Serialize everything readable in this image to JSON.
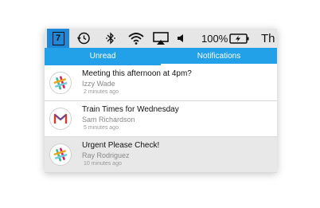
{
  "menubar": {
    "app_icon_label": "7",
    "battery_percent": "100%",
    "user_label": "Th"
  },
  "tabs": [
    {
      "label": "Unread"
    },
    {
      "label": "Notifications"
    }
  ],
  "notifications": [
    {
      "title": "Meeting this afternoon at 4pm?",
      "sender": "Izzy Wade",
      "time": "2 minutes ago",
      "icon": "slack-icon"
    },
    {
      "title": "Train Times for Wednesday",
      "sender": "Sam Richardson",
      "time": "5 minutes ago",
      "icon": "gmail-icon"
    },
    {
      "title": "Urgent Please Check!",
      "sender": "Ray Rodriguez",
      "time": "10 minutes  ago",
      "icon": "slack-icon"
    }
  ],
  "colors": {
    "accent": "#22a0e8",
    "menubar_bg": "#e6e6e6",
    "selected_row": "#e8e8e8"
  }
}
